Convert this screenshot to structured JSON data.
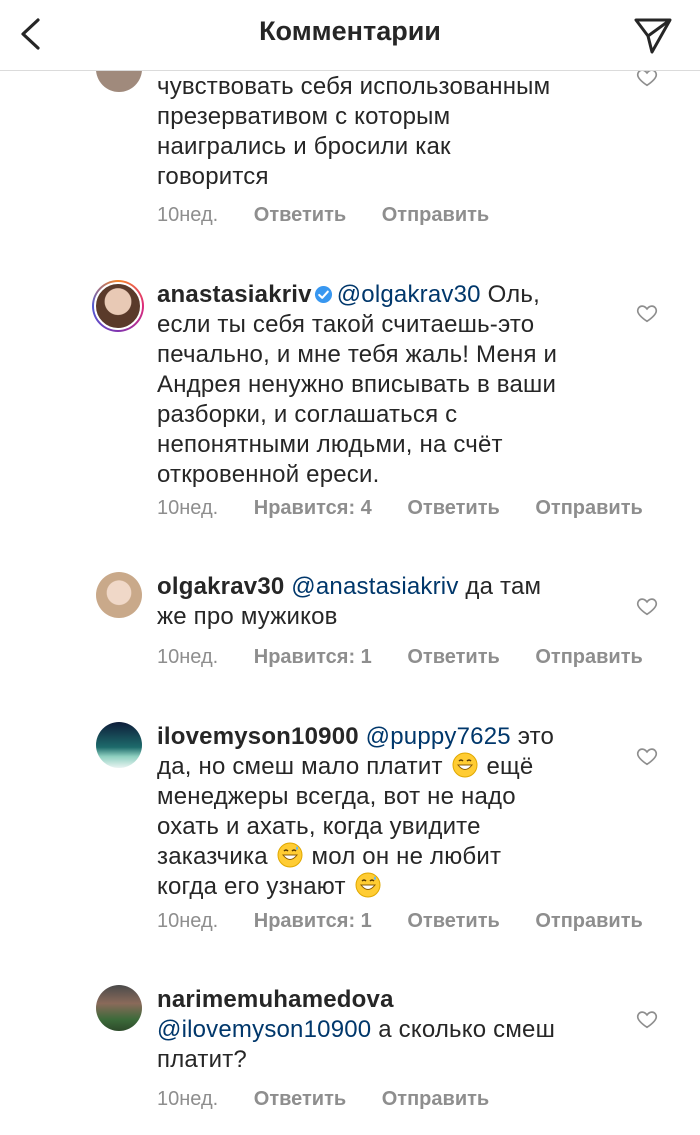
{
  "header": {
    "title": "Комментарии"
  },
  "comments": [
    {
      "username": "",
      "mention": "",
      "lines": [
        "чувствовать себя использованным",
        "презервативом с которым",
        "наигрались и бросили как",
        "говорится"
      ],
      "time": "10нед.",
      "likes": "",
      "reply": "Ответить",
      "send": "Отправить"
    },
    {
      "username": "anastasiakriv",
      "mention": "@olgakrav30",
      "line1_rest": "Оль,",
      "lines": [
        "если ты себя такой считаешь-это",
        "печально, и мне тебя жаль! Меня и",
        "Андрея ненужно вписывать в ваши",
        "разборки, и соглашаться с",
        "непонятными людьми, на счёт",
        "откровенной ереси."
      ],
      "time": "10нед.",
      "likes": "Нравится: 4",
      "reply": "Ответить",
      "send": "Отправить"
    },
    {
      "username": "olgakrav30",
      "mention": "@anastasiakriv",
      "line1_rest": "да там",
      "lines": [
        "же про мужиков"
      ],
      "time": "10нед.",
      "likes": "Нравится: 1",
      "reply": "Ответить",
      "send": "Отправить"
    },
    {
      "username": "ilovemyson10900",
      "mention": "@puppy7625",
      "line1_rest": "это",
      "line2a": "да, но смеш мало платит",
      "line2b": "ещё",
      "line3": "менеджеры всегда, вот не надо",
      "line4": "охать и ахать, когда увидите",
      "line5a": "заказчика",
      "line5b": "мол он не любит",
      "line6": "когда его узнают",
      "time": "10нед.",
      "likes": "Нравится: 1",
      "reply": "Ответить",
      "send": "Отправить"
    },
    {
      "username": "narimemuhamedova",
      "mention": "@ilovemyson10900",
      "line2_rest": "а сколько смеш",
      "lines": [
        "платит?"
      ],
      "time": "10нед.",
      "likes": "",
      "reply": "Ответить",
      "send": "Отправить"
    }
  ]
}
